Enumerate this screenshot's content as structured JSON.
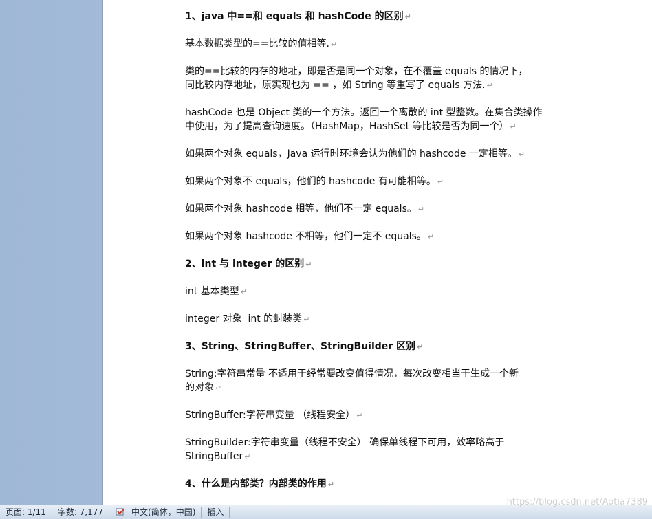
{
  "document": {
    "paragraphs": [
      {
        "text": "1、java 中==和 equals 和 hashCode 的区别",
        "heading": true
      },
      {
        "text": "基本数据类型的==比较的值相等.",
        "heading": false
      },
      {
        "text": "类的==比较的内存的地址，即是否是同一个对象，在不覆盖 equals 的情况下，\n同比较内存地址，原实现也为 == ，如 String 等重写了 equals 方法.",
        "heading": false
      },
      {
        "text": "hashCode 也是 Object 类的一个方法。返回一个离散的 int 型整数。在集合类操作\n中使用，为了提高查询速度。（HashMap，HashSet 等比较是否为同一个）",
        "heading": false
      },
      {
        "text": "如果两个对象 equals，Java 运行时环境会认为他们的 hashcode 一定相等。",
        "heading": false
      },
      {
        "text": "如果两个对象不 equals，他们的 hashcode 有可能相等。",
        "heading": false
      },
      {
        "text": "如果两个对象 hashcode 相等，他们不一定 equals。",
        "heading": false
      },
      {
        "text": "如果两个对象 hashcode 不相等，他们一定不 equals。",
        "heading": false
      },
      {
        "text": "2、int 与 integer 的区别",
        "heading": true
      },
      {
        "text": "int 基本类型",
        "heading": false
      },
      {
        "text": "integer 对象  int 的封装类",
        "heading": false
      },
      {
        "text": "3、String、StringBuffer、StringBuilder 区别",
        "heading": true
      },
      {
        "text": "String:字符串常量 不适用于经常要改变值得情况，每次改变相当于生成一个新\n的对象",
        "heading": false
      },
      {
        "text": "StringBuffer:字符串变量 （线程安全）",
        "heading": false
      },
      {
        "text": "StringBuilder:字符串变量（线程不安全） 确保单线程下可用，效率略高于\nStringBuffer",
        "heading": false
      },
      {
        "text": "4、什么是内部类？内部类的作用",
        "heading": true
      }
    ],
    "paragraph_mark": "↵"
  },
  "statusbar": {
    "page": "页面: 1/11",
    "word_count": "字数: 7,177",
    "language": "中文(简体，中国)",
    "insert_mode": "插入"
  },
  "watermark": "https://blog.csdn.net/Aotia7389",
  "colors": {
    "workspace": "#a9c0dc",
    "statusbar": "#dde6f2"
  },
  "icons": {
    "proofing": "spelling-check-icon"
  }
}
